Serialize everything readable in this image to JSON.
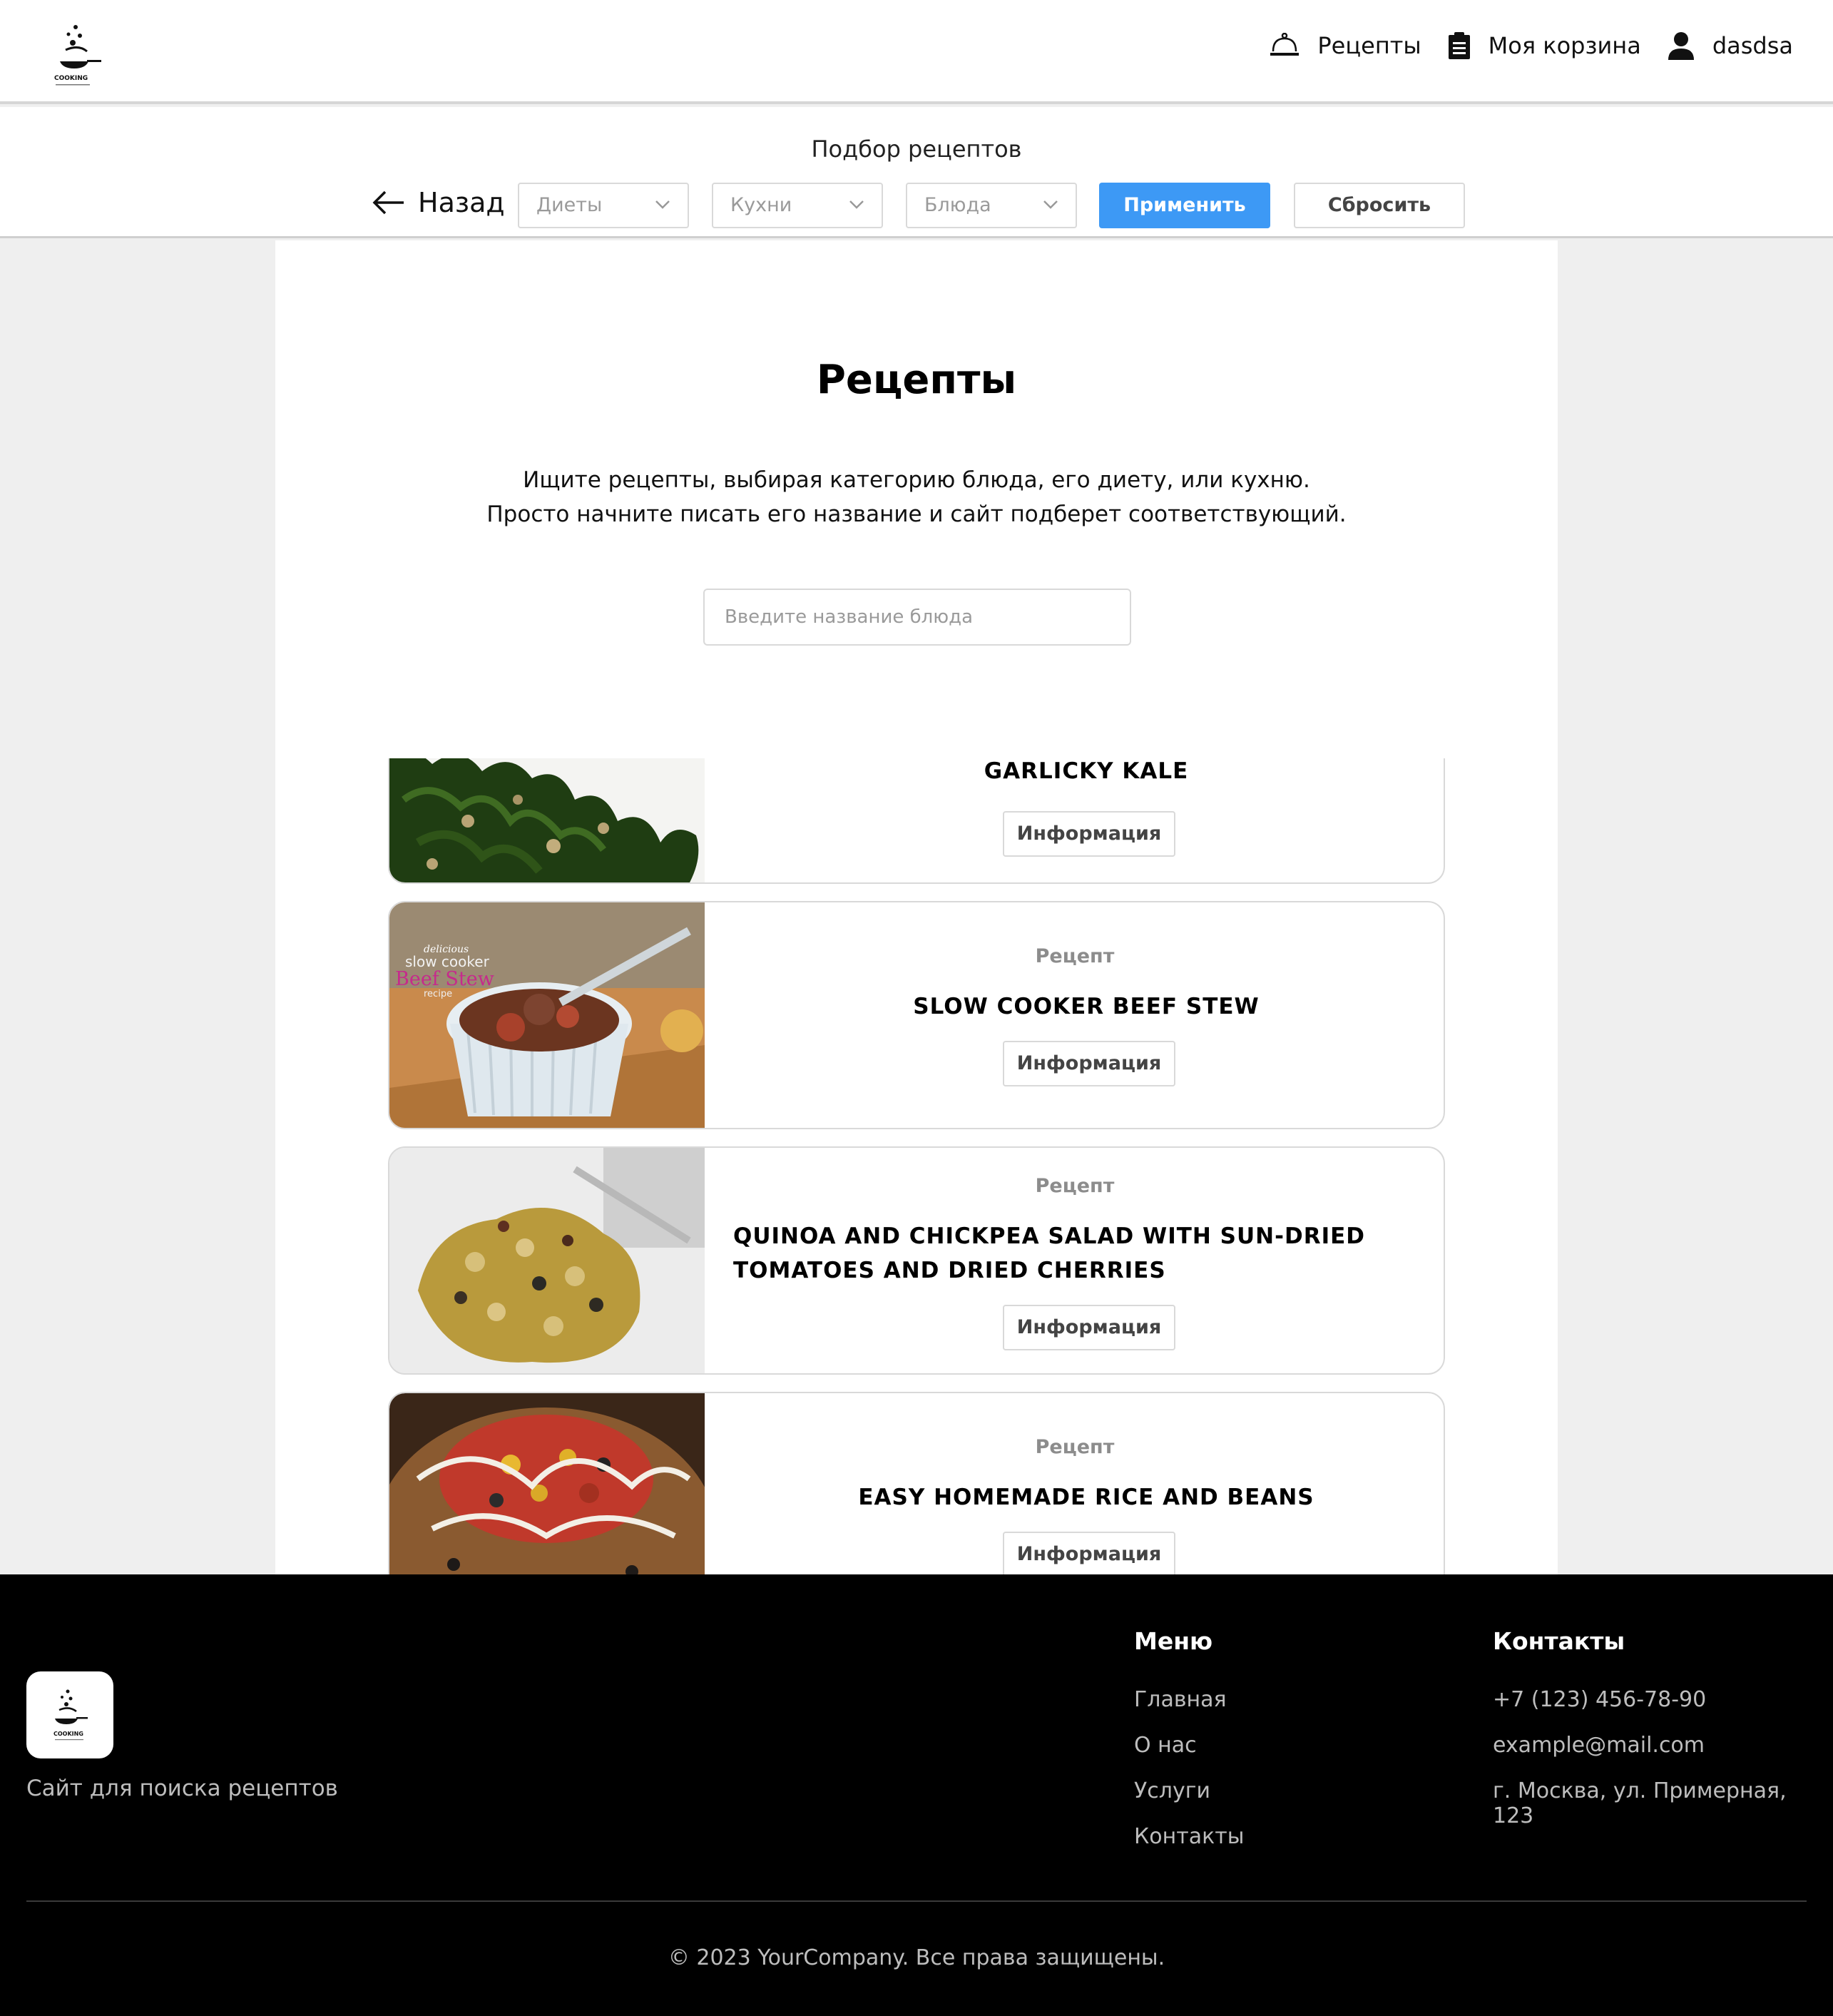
{
  "header": {
    "logo_text": "COOKING",
    "nav": [
      {
        "label": "Рецепты",
        "icon": "service-bell-icon"
      },
      {
        "label": "Моя корзина",
        "icon": "clipboard-icon"
      },
      {
        "label": "dasdsa",
        "icon": "user-icon"
      }
    ]
  },
  "filters": {
    "title": "Подбор рецептов",
    "back_label": "Назад",
    "diets_placeholder": "Диеты",
    "cuisines_placeholder": "Кухни",
    "dishes_placeholder": "Блюда",
    "apply_label": "Применить",
    "reset_label": "Сбросить"
  },
  "main": {
    "title": "Рецепты",
    "description_line1": "Ищите рецепты, выбирая категорию блюда, его диету, или кухню.",
    "description_line2": "Просто начните писать его название и сайт подберет соответствующий.",
    "search_placeholder": "Введите название блюда"
  },
  "recipes": [
    {
      "label": "",
      "title": "GARLICKY KALE",
      "button": "Информация",
      "image": "kale-photo"
    },
    {
      "label": "Рецепт",
      "title": "SLOW COOKER BEEF STEW",
      "button": "Информация",
      "image": "beef-stew-photo",
      "image_text_1": "delicious",
      "image_text_2": "slow cooker",
      "image_text_3": "Beef Stew",
      "image_text_4": "recipe"
    },
    {
      "label": "Рецепт",
      "title": "QUINOA AND CHICKPEA SALAD WITH SUN-DRIED TOMATOES AND DRIED CHERRIES",
      "button": "Информация",
      "image": "quinoa-salad-photo"
    },
    {
      "label": "Рецепт",
      "title": "EASY HOMEMADE RICE AND BEANS",
      "button": "Информация",
      "image": "rice-beans-photo"
    }
  ],
  "footer": {
    "tagline": "Сайт для поиска рецептов",
    "menu_title": "Меню",
    "menu": [
      "Главная",
      "О нас",
      "Услуги",
      "Контакты"
    ],
    "contacts_title": "Контакты",
    "phone": "+7 (123) 456-78-90",
    "email": "example@mail.com",
    "address": "г. Москва, ул. Примерная, 123",
    "copyright": "© 2023 YourCompany. Все права защищены."
  },
  "colors": {
    "accent": "#3d99f5",
    "footer_bg": "#000000",
    "page_bg": "#efefef"
  }
}
